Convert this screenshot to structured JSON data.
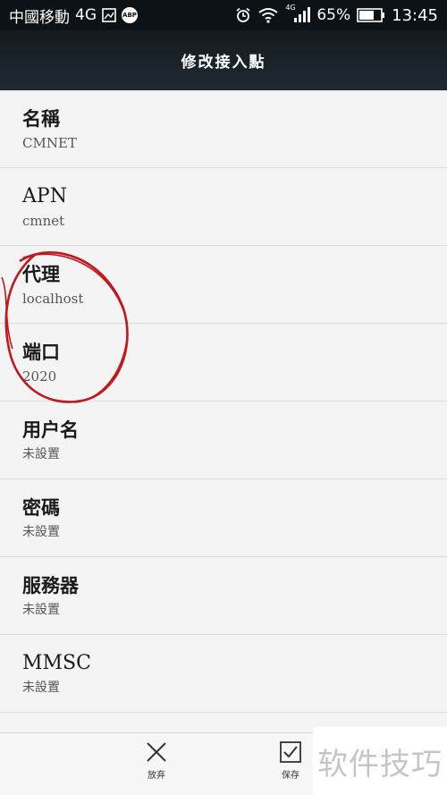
{
  "status_bar": {
    "carrier": "中國移動",
    "network": "4G",
    "network_small": "4G",
    "battery": "65%",
    "time": "13:45",
    "abp_badge": "ABP"
  },
  "header": {
    "title": "修改接入點"
  },
  "fields": [
    {
      "label": "名稱",
      "value": "CMNET"
    },
    {
      "label": "APN",
      "value": "cmnet"
    },
    {
      "label": "代理",
      "value": "localhost"
    },
    {
      "label": "端口",
      "value": "2020"
    },
    {
      "label": "用户名",
      "value": "未設置"
    },
    {
      "label": "密碼",
      "value": "未設置"
    },
    {
      "label": "服務器",
      "value": "未設置"
    },
    {
      "label": "MMSC",
      "value": "未設置"
    }
  ],
  "bottom_bar": {
    "discard_label": "放弃",
    "save_label": "保存"
  },
  "watermark": "软件技巧",
  "colors": {
    "status_bg": "#0d1216",
    "title_bg": "#1f2a31",
    "annotation": "#c0181f"
  }
}
